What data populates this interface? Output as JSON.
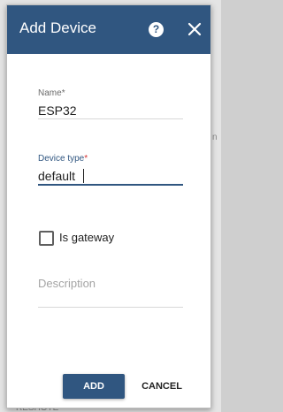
{
  "background": {
    "fragment_top": "n",
    "fragment_bottom": "RESHOTE"
  },
  "dialog": {
    "title": "Add Device",
    "help_symbol": "?",
    "close_icon": "close-icon",
    "help_icon": "help-circle-icon",
    "header_color": "#305680",
    "fields": {
      "name": {
        "label": "Name",
        "required_mark": "*",
        "value": "ESP32"
      },
      "device_type": {
        "label": "Device type",
        "required_mark": "*",
        "value": "default",
        "focused": true
      },
      "is_gateway": {
        "label": "Is gateway",
        "checked": false
      },
      "description": {
        "placeholder": "Description",
        "value": ""
      }
    },
    "buttons": {
      "add": "ADD",
      "cancel": "CANCEL"
    }
  }
}
